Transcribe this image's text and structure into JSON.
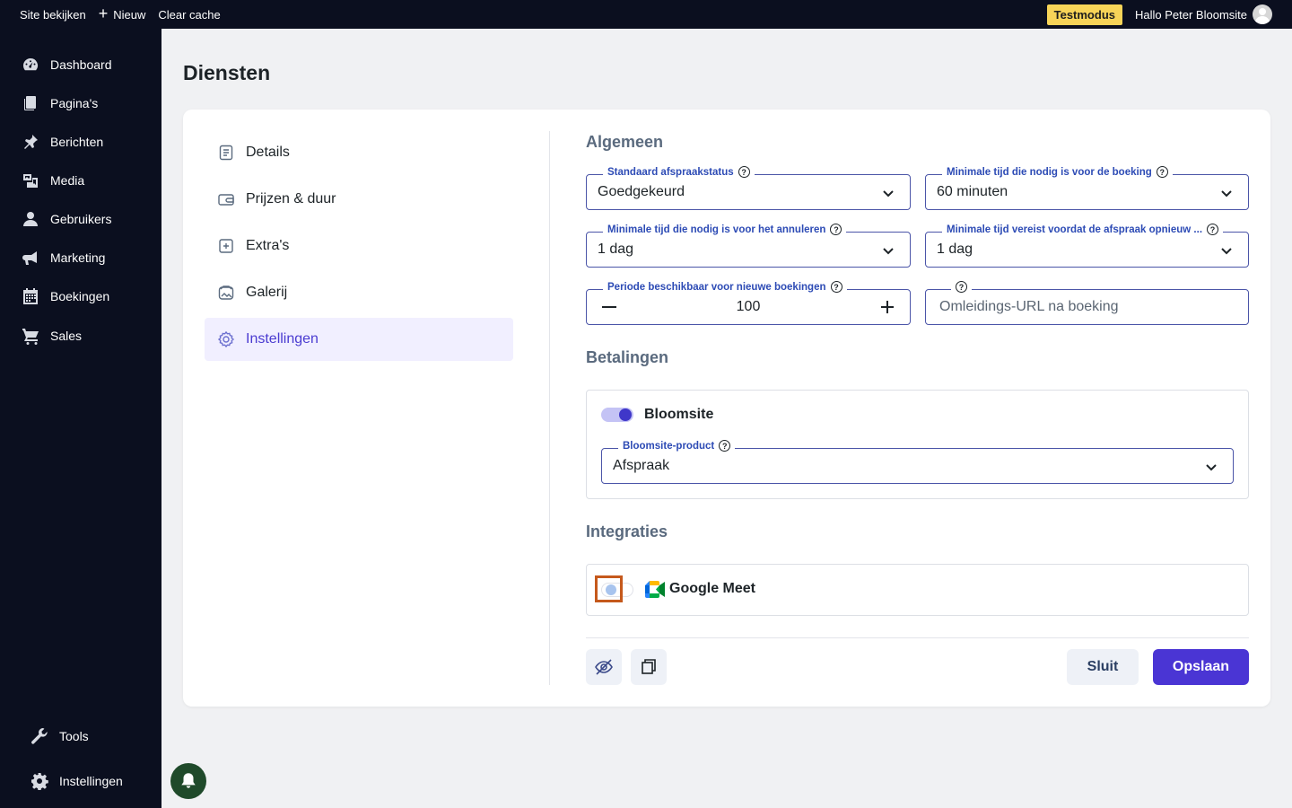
{
  "topbar": {
    "view_site": "Site bekijken",
    "new": "Nieuw",
    "clear_cache": "Clear cache",
    "test_mode": "Testmodus",
    "greeting": "Hallo Peter Bloomsite"
  },
  "sidebar": {
    "items": [
      {
        "label": "Dashboard",
        "icon": "dashboard-icon"
      },
      {
        "label": "Pagina's",
        "icon": "pages-icon"
      },
      {
        "label": "Berichten",
        "icon": "pin-icon"
      },
      {
        "label": "Media",
        "icon": "media-icon"
      },
      {
        "label": "Gebruikers",
        "icon": "user-icon"
      },
      {
        "label": "Marketing",
        "icon": "megaphone-icon"
      },
      {
        "label": "Boekingen",
        "icon": "calendar-icon"
      },
      {
        "label": "Sales",
        "icon": "cart-icon"
      }
    ],
    "bottom": [
      {
        "label": "Tools",
        "icon": "wrench-icon"
      },
      {
        "label": "Instellingen",
        "icon": "gear-icon"
      }
    ]
  },
  "page": {
    "title": "Diensten"
  },
  "menu": {
    "items": [
      {
        "label": "Details",
        "active": false
      },
      {
        "label": "Prijzen & duur",
        "active": false
      },
      {
        "label": "Extra's",
        "active": false
      },
      {
        "label": "Galerij",
        "active": false
      },
      {
        "label": "Instellingen",
        "active": true
      }
    ]
  },
  "general": {
    "title": "Algemeen",
    "default_status": {
      "label": "Standaard afspraakstatus",
      "value": "Goedgekeurd"
    },
    "min_booking_time": {
      "label": "Minimale tijd die nodig is voor de boeking",
      "value": "60 minuten"
    },
    "min_cancel_time": {
      "label": "Minimale tijd die nodig is voor het annuleren",
      "value": "1 dag"
    },
    "min_reschedule_time": {
      "label": "Minimale tijd vereist voordat de afspraak opnieuw ...",
      "value": "1 dag"
    },
    "booking_period": {
      "label": "Periode beschikbaar voor nieuwe boekingen",
      "value": "100"
    },
    "redirect_url": {
      "placeholder": "Omleidings-URL na boeking"
    }
  },
  "payments": {
    "title": "Betalingen",
    "provider": "Bloomsite",
    "provider_enabled": true,
    "product": {
      "label": "Bloomsite-product",
      "value": "Afspraak"
    }
  },
  "integrations": {
    "title": "Integraties",
    "google_meet": "Google Meet",
    "google_meet_enabled": false
  },
  "footer": {
    "close": "Sluit",
    "save": "Opslaan"
  },
  "colors": {
    "accent": "#4a35d4",
    "sidebar_bg": "#0b0f1f",
    "test_badge": "#f7d458"
  }
}
